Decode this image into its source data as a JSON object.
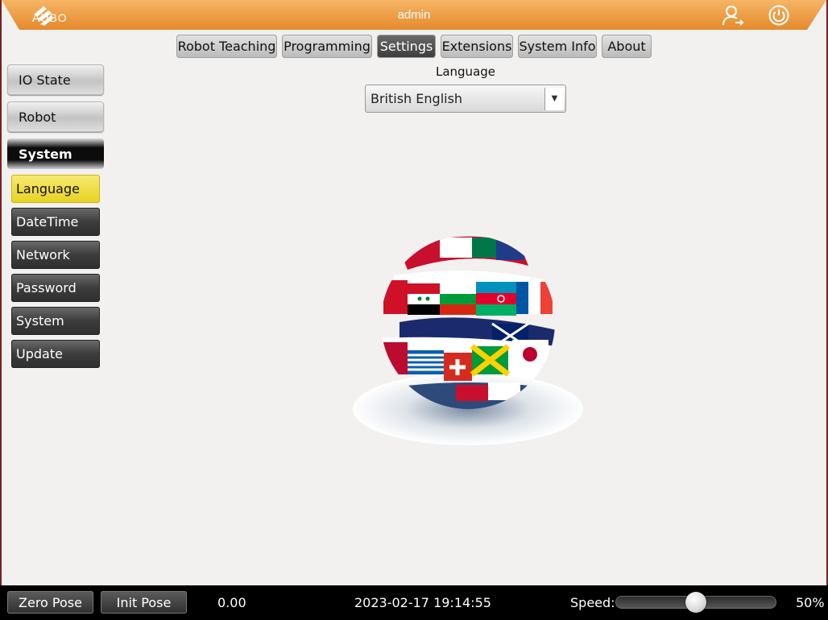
{
  "header": {
    "logo_text": "AUBO",
    "user": "admin",
    "user_icon": "user-switch-icon",
    "power_icon": "power-icon",
    "accent_color": "#f0a04a"
  },
  "tabs": [
    {
      "label": "Robot Teaching",
      "active": false
    },
    {
      "label": "Programming",
      "active": false
    },
    {
      "label": "Settings",
      "active": true
    },
    {
      "label": "Extensions",
      "active": false
    },
    {
      "label": "System Info",
      "active": false
    },
    {
      "label": "About",
      "active": false
    }
  ],
  "sidebar": {
    "sections": [
      {
        "label": "IO State",
        "active": false
      },
      {
        "label": "Robot",
        "active": false
      },
      {
        "label": "System",
        "active": true
      }
    ],
    "subitems": [
      {
        "label": "Language",
        "active": true
      },
      {
        "label": "DateTime",
        "active": false
      },
      {
        "label": "Network",
        "active": false
      },
      {
        "label": "Password",
        "active": false
      },
      {
        "label": "System",
        "active": false
      },
      {
        "label": "Update",
        "active": false
      }
    ]
  },
  "language": {
    "label": "Language",
    "selected": "British English"
  },
  "footer": {
    "zero_pose": "Zero Pose",
    "init_pose": "Init Pose",
    "value": "0.00",
    "datetime": "2023-02-17 19:14:55",
    "speed_label": "Speed:",
    "speed_value": "50%",
    "speed_fraction": 0.5
  }
}
